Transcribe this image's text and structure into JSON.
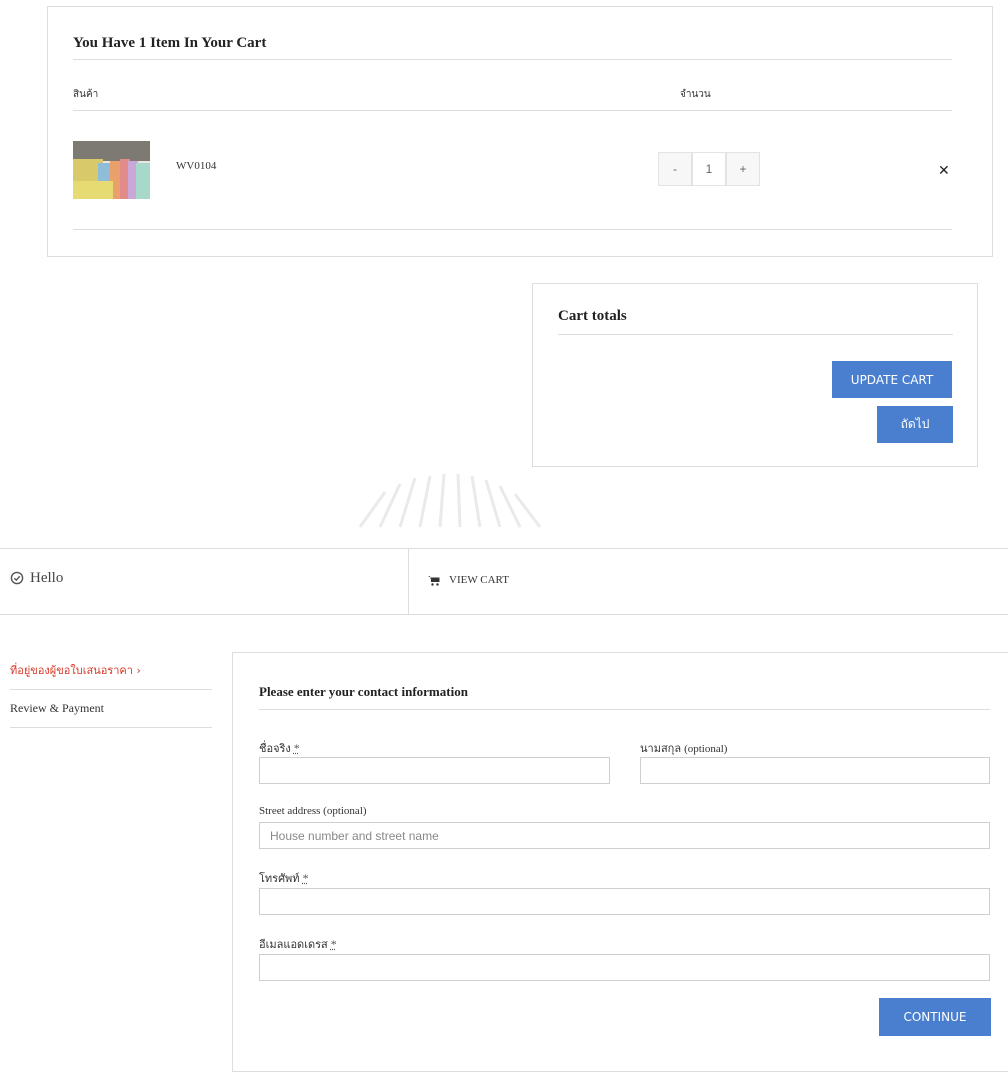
{
  "cart": {
    "title": "You Have 1 Item In Your Cart",
    "col_product": "สินค้า",
    "col_qty": "จำนวน",
    "item": {
      "name": "WV0104",
      "qty": "1",
      "minus": "-",
      "plus": "+",
      "remove": "✕"
    }
  },
  "totals": {
    "title": "Cart totals",
    "update_label": "UPDATE CART",
    "next_label": "ถัดไป"
  },
  "steps": {
    "hello": "Hello",
    "view_cart": "VIEW CART"
  },
  "sidebar": {
    "items": [
      {
        "label": "ที่อยู่ของผู้ขอใบเสนอราคา ›"
      },
      {
        "label": "Review & Payment"
      }
    ]
  },
  "form": {
    "title": "Please enter your contact information",
    "first_name_label": "ชื่อจริง",
    "last_name_label": "นามสกุล",
    "optional": "(optional)",
    "street_label": "Street address",
    "street_placeholder": "House number and street name",
    "phone_label": "โทรศัพท์",
    "email_label": "อีเมลแอดเดรส",
    "required_mark": "*",
    "continue_label": "CONTINUE"
  },
  "colors": {
    "accent": "#4a7fd0",
    "active_step": "#d83a2b",
    "border": "#dddddd"
  }
}
